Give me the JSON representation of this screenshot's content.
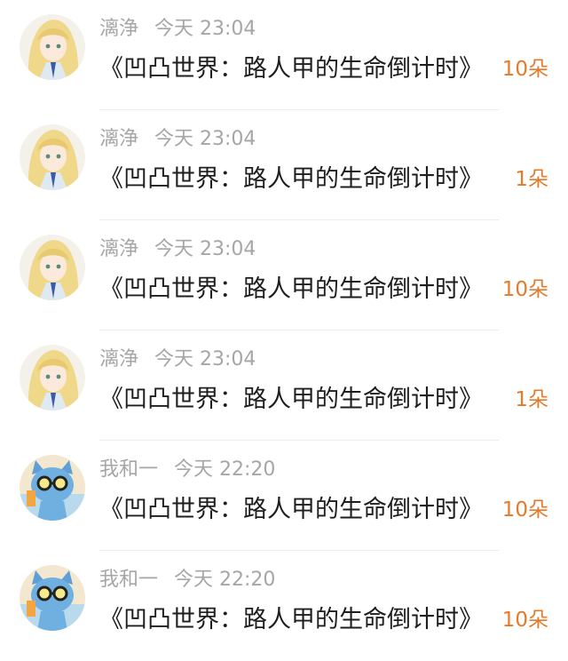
{
  "messages": [
    {
      "avatar": "anime-girl-avatar",
      "name": "漓浄",
      "time": "今天 23:04",
      "title": "《凹凸世界：路人甲的生命倒计时》",
      "truncated": true,
      "count": "10朵"
    },
    {
      "avatar": "anime-girl-avatar",
      "name": "漓浄",
      "time": "今天 23:04",
      "title": "《凹凸世界：路人甲的生命倒计时》",
      "truncated": false,
      "count": "1朵"
    },
    {
      "avatar": "anime-girl-avatar",
      "name": "漓浄",
      "time": "今天 23:04",
      "title": "《凹凸世界：路人甲的生命倒计时》",
      "truncated": true,
      "count": "10朵"
    },
    {
      "avatar": "anime-girl-avatar",
      "name": "漓浄",
      "time": "今天 23:04",
      "title": "《凹凸世界：路人甲的生命倒计时》",
      "truncated": false,
      "count": "1朵"
    },
    {
      "avatar": "blue-cat-avatar",
      "name": "我和一",
      "time": "今天 22:20",
      "title": "《凹凸世界：路人甲的生命倒计时》",
      "truncated": true,
      "count": "10朵"
    },
    {
      "avatar": "blue-cat-avatar",
      "name": "我和一",
      "time": "今天 22:20",
      "title": "《凹凸世界：路人甲的生命倒计时》",
      "truncated": true,
      "count": "10朵"
    }
  ],
  "colors": {
    "count": "#e47a2a",
    "meta": "#a6a6a6",
    "title": "#1e1e1e",
    "divider": "#ececec"
  }
}
